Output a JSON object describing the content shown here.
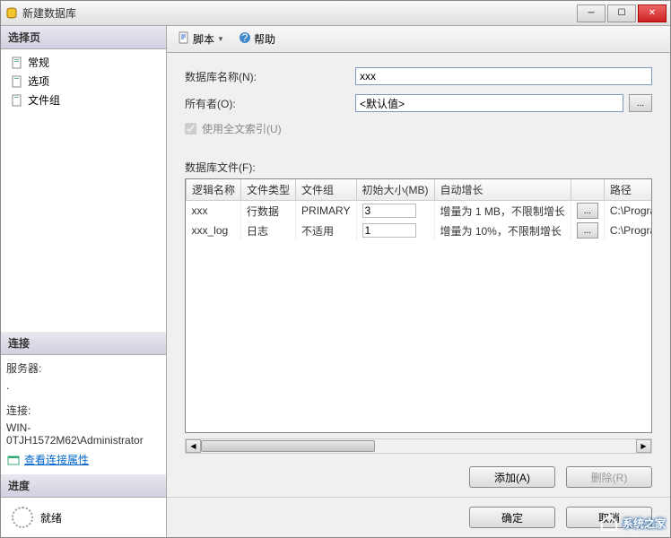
{
  "title": "新建数据库",
  "sidebar": {
    "select_header": "选择页",
    "items": [
      {
        "label": "常规"
      },
      {
        "label": "选项"
      },
      {
        "label": "文件组"
      }
    ],
    "conn_header": "连接",
    "server_label": "服务器:",
    "server_value": ".",
    "conn_label": "连接:",
    "conn_value": "WIN-0TJH1572M62\\Administrator",
    "view_conn_props": "查看连接属性",
    "progress_header": "进度",
    "progress_status": "就绪"
  },
  "toolbar": {
    "script": "脚本",
    "help": "帮助"
  },
  "form": {
    "db_name_label": "数据库名称(N):",
    "db_name_value": "xxx",
    "owner_label": "所有者(O):",
    "owner_value": "<默认值>",
    "fulltext_label": "使用全文索引(U)",
    "files_label": "数据库文件(F):"
  },
  "grid": {
    "headers": [
      "逻辑名称",
      "文件类型",
      "文件组",
      "初始大小(MB)",
      "自动增长",
      "",
      "路径"
    ],
    "rows": [
      {
        "name": "xxx",
        "type": "行数据",
        "group": "PRIMARY",
        "size": "3",
        "growth": "增量为 1 MB，不限制增长",
        "path": "C:\\Program Files\\Mic"
      },
      {
        "name": "xxx_log",
        "type": "日志",
        "group": "不适用",
        "size": "1",
        "growth": "增量为 10%，不限制增长",
        "path": "C:\\Program Files\\Mic"
      }
    ]
  },
  "buttons": {
    "add": "添加(A)",
    "remove": "删除(R)",
    "ok": "确定",
    "cancel": "取消"
  },
  "watermark": "系统之家"
}
